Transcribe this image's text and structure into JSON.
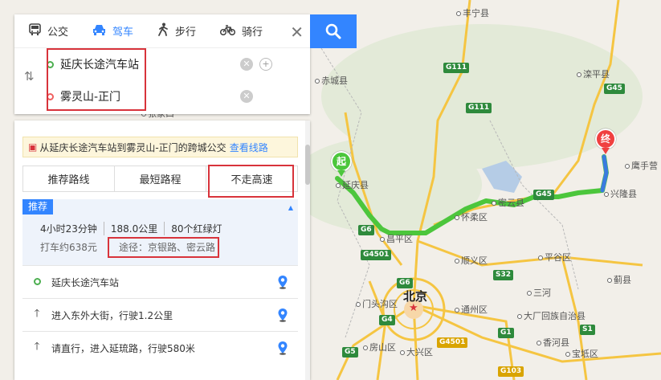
{
  "modes": [
    {
      "label": "公交",
      "icon": "bus-icon"
    },
    {
      "label": "驾车",
      "icon": "car-icon"
    },
    {
      "label": "步行",
      "icon": "walk-icon"
    },
    {
      "label": "骑行",
      "icon": "bike-icon"
    }
  ],
  "active_mode": "驾车",
  "start": {
    "value": "延庆长途汽车站"
  },
  "end": {
    "value": "雾灵山-正门"
  },
  "notice": {
    "text": "从延庆长途汽车站到雾灵山-正门的跨城公交",
    "link": "查看线路"
  },
  "prefs": [
    "推荐路线",
    "最短路程",
    "不走高速"
  ],
  "route": {
    "badge": "推荐",
    "time": "4小时23分钟",
    "distance": "188.0公里",
    "lights": "80个红绿灯",
    "taxi": "打车约638元",
    "via": "途径：京银路、密云路"
  },
  "steps": [
    {
      "text": "延庆长途汽车站",
      "icon": "start-ring-icon"
    },
    {
      "text": "进入东外大街，行驶1.2公里",
      "icon": "straight-arrow-icon"
    },
    {
      "text": "请直行，进入延琉路，行驶580米",
      "icon": "straight-arrow-icon"
    }
  ],
  "map": {
    "places": [
      "丰宁县",
      "赤城县",
      "滦平县",
      "鹰手营",
      "延庆县",
      "密云县",
      "兴隆县",
      "怀柔区",
      "昌平区",
      "顺义区",
      "平谷区",
      "蓟县",
      "三河",
      "通州区",
      "大厂回族自治县",
      "香河县",
      "宝坻区",
      "房山区",
      "大兴区",
      "门头沟区",
      "张家口"
    ],
    "city": "北京",
    "roads": [
      "G111",
      "G111",
      "G45",
      "G45",
      "G6",
      "G4501",
      "G6",
      "G4",
      "G5",
      "S32",
      "G1",
      "S1",
      "G4501",
      "G103"
    ],
    "start_pin": "起",
    "end_pin": "终"
  },
  "colors": {
    "accent": "#3385ff",
    "route": "#4cc63c",
    "highlight": "#d8333b",
    "start": "#4caf50",
    "end": "#f06060"
  }
}
